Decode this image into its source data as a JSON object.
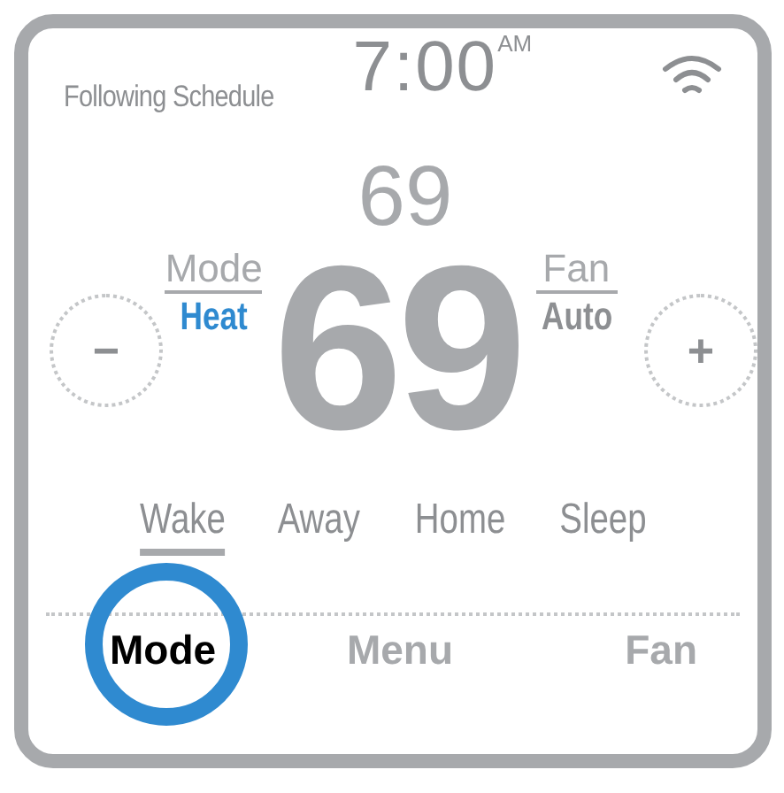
{
  "status": "Following Schedule",
  "clock": {
    "time": "7:00",
    "period": "AM"
  },
  "setpoint": "69",
  "mode": {
    "label": "Mode",
    "value": "Heat"
  },
  "temperature": "69",
  "fan": {
    "label": "Fan",
    "value": "Auto"
  },
  "adjust_buttons": [
    {
      "symbol": "−"
    },
    {
      "symbol": "+"
    }
  ],
  "schedule": [
    {
      "label": "Wake",
      "selected": true
    },
    {
      "label": "Away",
      "selected": false
    },
    {
      "label": "Home",
      "selected": false
    },
    {
      "label": "Sleep",
      "selected": false
    }
  ],
  "softkeys": [
    {
      "label": "Mode",
      "highlighted": true
    },
    {
      "label": "Menu",
      "highlighted": false
    },
    {
      "label": "Fan",
      "highlighted": false
    }
  ]
}
